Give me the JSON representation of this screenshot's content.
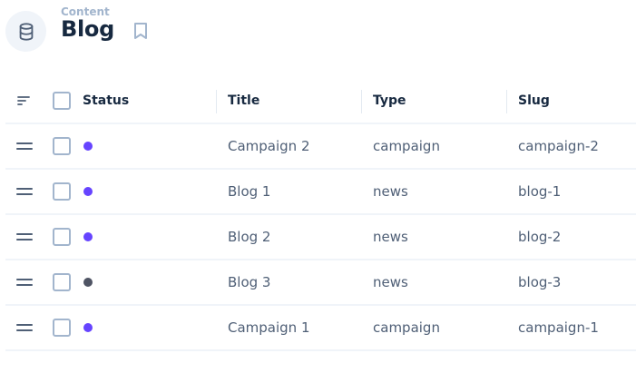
{
  "header": {
    "breadcrumb": "Content",
    "title": "Blog"
  },
  "table": {
    "columns": [
      {
        "key": "status",
        "label": "Status"
      },
      {
        "key": "title",
        "label": "Title"
      },
      {
        "key": "type",
        "label": "Type"
      },
      {
        "key": "slug",
        "label": "Slug"
      }
    ],
    "rows": [
      {
        "status_color": "#6644ff",
        "title": "Campaign 2",
        "type": "campaign",
        "slug": "campaign-2"
      },
      {
        "status_color": "#6644ff",
        "title": "Blog 1",
        "type": "news",
        "slug": "blog-1"
      },
      {
        "status_color": "#6644ff",
        "title": "Blog 2",
        "type": "news",
        "slug": "blog-2"
      },
      {
        "status_color": "#4f5464",
        "title": "Blog 3",
        "type": "news",
        "slug": "blog-3"
      },
      {
        "status_color": "#6644ff",
        "title": "Campaign 1",
        "type": "campaign",
        "slug": "campaign-1"
      }
    ]
  },
  "icons": {
    "collection": "database-icon",
    "bookmark": "bookmark-icon",
    "sort": "sort-lines-icon",
    "drag": "drag-handle-icon"
  }
}
